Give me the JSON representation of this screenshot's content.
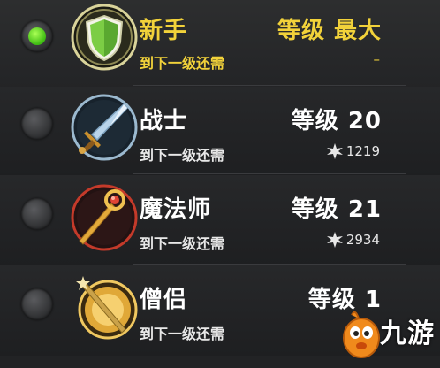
{
  "classes": [
    {
      "id": "novice",
      "name": "新手",
      "level_label": "等级",
      "level_value": "最大",
      "next_label": "到下一级还需",
      "xp": "–",
      "selected": true,
      "emblem": "shield-icon"
    },
    {
      "id": "warrior",
      "name": "战士",
      "level_label": "等级",
      "level_value": "20",
      "next_label": "到下一级还需",
      "xp": "1219",
      "selected": false,
      "emblem": "sword-icon"
    },
    {
      "id": "mage",
      "name": "魔法师",
      "level_label": "等级",
      "level_value": "21",
      "next_label": "到下一级还需",
      "xp": "2934",
      "selected": false,
      "emblem": "staff-icon"
    },
    {
      "id": "monk",
      "name": "僧侣",
      "level_label": "等级",
      "level_value": "1",
      "next_label": "到下一级还需",
      "xp": "",
      "selected": false,
      "emblem": "mace-icon"
    }
  ],
  "watermark": {
    "text": "九游"
  },
  "colors": {
    "selected_text": "#f2d23a",
    "normal_text": "#ffffff",
    "radio_active": "#3dbb12",
    "background": "#222325"
  }
}
